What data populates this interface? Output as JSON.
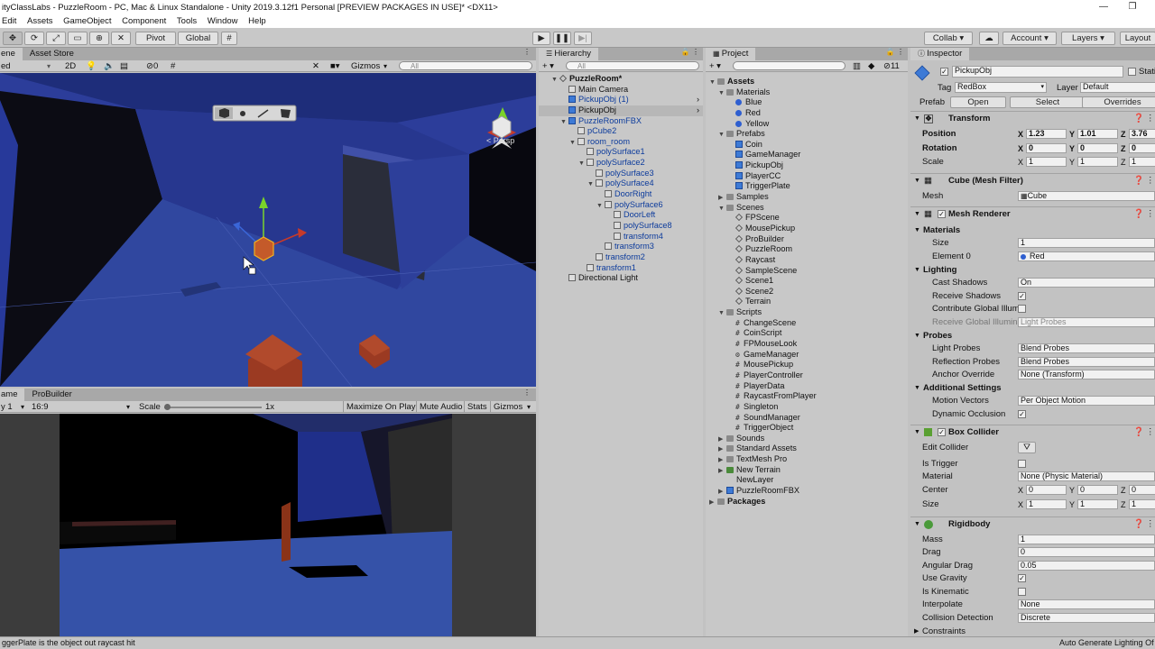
{
  "window": {
    "title": "ityClassLabs - PuzzleRoom - PC, Mac & Linux Standalone - Unity 2019.3.12f1 Personal [PREVIEW PACKAGES IN USE]* <DX11>"
  },
  "menu": [
    "Edit",
    "Assets",
    "GameObject",
    "Component",
    "Tools",
    "Window",
    "Help"
  ],
  "toolbar": {
    "pivot": "Pivot",
    "global": "Global",
    "collab": "Collab",
    "account": "Account",
    "layers": "Layers",
    "layout": "Layout"
  },
  "scene": {
    "tab_scene": "ene",
    "tab_store": "Asset Store",
    "shading": "ed",
    "mode2d": "2D",
    "hidden_count": "0",
    "gizmos": "Gizmos",
    "search_placeholder": "All",
    "persp": "Persp"
  },
  "game": {
    "tab_game": "ame",
    "tab_probuilder": "ProBuilder",
    "display": "y 1",
    "aspect": "16:9",
    "scale_label": "Scale",
    "scale_value": "1x",
    "scale_fraction": 0.0,
    "maximize": "Maximize On Play",
    "mute": "Mute Audio",
    "stats": "Stats",
    "gizmos": "Gizmos"
  },
  "hierarchy": {
    "tab": "Hierarchy",
    "search_placeholder": "All",
    "items": [
      {
        "label": "PuzzleRoom*",
        "depth": 0,
        "arrow": "▼",
        "icon": "unity",
        "bold": true
      },
      {
        "label": "Main Camera",
        "depth": 1,
        "arrow": "",
        "icon": "gray"
      },
      {
        "label": "PickupObj (1)",
        "depth": 1,
        "arrow": "",
        "icon": "blue",
        "blue": true,
        "chev": true
      },
      {
        "label": "PickupObj",
        "depth": 1,
        "arrow": "",
        "icon": "blue",
        "sel": true,
        "chev": true
      },
      {
        "label": "PuzzleRoomFBX",
        "depth": 1,
        "arrow": "▼",
        "icon": "blue",
        "blue": true
      },
      {
        "label": "pCube2",
        "depth": 2,
        "arrow": "",
        "icon": "gray",
        "blue": true
      },
      {
        "label": "room_room",
        "depth": 2,
        "arrow": "▼",
        "icon": "gray",
        "blue": true
      },
      {
        "label": "polySurface1",
        "depth": 3,
        "arrow": "",
        "icon": "gray",
        "blue": true
      },
      {
        "label": "polySurface2",
        "depth": 3,
        "arrow": "▼",
        "icon": "gray",
        "blue": true
      },
      {
        "label": "polySurface3",
        "depth": 4,
        "arrow": "",
        "icon": "gray",
        "blue": true
      },
      {
        "label": "polySurface4",
        "depth": 4,
        "arrow": "▼",
        "icon": "gray",
        "blue": true
      },
      {
        "label": "DoorRight",
        "depth": 5,
        "arrow": "",
        "icon": "gray",
        "blue": true
      },
      {
        "label": "polySurface6",
        "depth": 5,
        "arrow": "▼",
        "icon": "gray",
        "blue": true
      },
      {
        "label": "DoorLeft",
        "depth": 6,
        "arrow": "",
        "icon": "gray",
        "blue": true
      },
      {
        "label": "polySurface8",
        "depth": 6,
        "arrow": "",
        "icon": "gray",
        "blue": true
      },
      {
        "label": "transform4",
        "depth": 6,
        "arrow": "",
        "icon": "gray",
        "blue": true
      },
      {
        "label": "transform3",
        "depth": 5,
        "arrow": "",
        "icon": "gray",
        "blue": true
      },
      {
        "label": "transform2",
        "depth": 4,
        "arrow": "",
        "icon": "gray",
        "blue": true
      },
      {
        "label": "transform1",
        "depth": 3,
        "arrow": "",
        "icon": "gray",
        "blue": true
      },
      {
        "label": "Directional Light",
        "depth": 1,
        "arrow": "",
        "icon": "gray"
      }
    ]
  },
  "project": {
    "tab": "Project",
    "hidden_count": "11",
    "items": [
      {
        "label": "Assets",
        "depth": 0,
        "arrow": "▼",
        "icon": "folder",
        "bold": true
      },
      {
        "label": "Materials",
        "depth": 1,
        "arrow": "▼",
        "icon": "folder"
      },
      {
        "label": "Blue",
        "depth": 2,
        "arrow": "",
        "icon": "dot",
        "color": "#2f5fd0"
      },
      {
        "label": "Red",
        "depth": 2,
        "arrow": "",
        "icon": "dot",
        "color": "#2f5fd0"
      },
      {
        "label": "Yellow",
        "depth": 2,
        "arrow": "",
        "icon": "dot",
        "color": "#2f5fd0"
      },
      {
        "label": "Prefabs",
        "depth": 1,
        "arrow": "▼",
        "icon": "folder"
      },
      {
        "label": "Coin",
        "depth": 2,
        "arrow": "",
        "icon": "blue"
      },
      {
        "label": "GameManager",
        "depth": 2,
        "arrow": "",
        "icon": "blue"
      },
      {
        "label": "PickupObj",
        "depth": 2,
        "arrow": "",
        "icon": "blue"
      },
      {
        "label": "PlayerCC",
        "depth": 2,
        "arrow": "",
        "icon": "blue"
      },
      {
        "label": "TriggerPlate",
        "depth": 2,
        "arrow": "",
        "icon": "blue"
      },
      {
        "label": "Samples",
        "depth": 1,
        "arrow": "▶",
        "icon": "folder"
      },
      {
        "label": "Scenes",
        "depth": 1,
        "arrow": "▼",
        "icon": "folder"
      },
      {
        "label": "FPScene",
        "depth": 2,
        "arrow": "",
        "icon": "unity"
      },
      {
        "label": "MousePickup",
        "depth": 2,
        "arrow": "",
        "icon": "unity"
      },
      {
        "label": "ProBuilder",
        "depth": 2,
        "arrow": "",
        "icon": "unity"
      },
      {
        "label": "PuzzleRoom",
        "depth": 2,
        "arrow": "",
        "icon": "unity"
      },
      {
        "label": "Raycast",
        "depth": 2,
        "arrow": "",
        "icon": "unity"
      },
      {
        "label": "SampleScene",
        "depth": 2,
        "arrow": "",
        "icon": "unity"
      },
      {
        "label": "Scene1",
        "depth": 2,
        "arrow": "",
        "icon": "unity"
      },
      {
        "label": "Scene2",
        "depth": 2,
        "arrow": "",
        "icon": "unity"
      },
      {
        "label": "Terrain",
        "depth": 2,
        "arrow": "",
        "icon": "unity"
      },
      {
        "label": "Scripts",
        "depth": 1,
        "arrow": "▼",
        "icon": "folder"
      },
      {
        "label": "ChangeScene",
        "depth": 2,
        "arrow": "",
        "icon": "script"
      },
      {
        "label": "CoinScript",
        "depth": 2,
        "arrow": "",
        "icon": "script"
      },
      {
        "label": "FPMouseLook",
        "depth": 2,
        "arrow": "",
        "icon": "script"
      },
      {
        "label": "GameManager",
        "depth": 2,
        "arrow": "",
        "icon": "gear"
      },
      {
        "label": "MousePickup",
        "depth": 2,
        "arrow": "",
        "icon": "script"
      },
      {
        "label": "PlayerController",
        "depth": 2,
        "arrow": "",
        "icon": "script"
      },
      {
        "label": "PlayerData",
        "depth": 2,
        "arrow": "",
        "icon": "script"
      },
      {
        "label": "RaycastFromPlayer",
        "depth": 2,
        "arrow": "",
        "icon": "script"
      },
      {
        "label": "Singleton",
        "depth": 2,
        "arrow": "",
        "icon": "script"
      },
      {
        "label": "SoundManager",
        "depth": 2,
        "arrow": "",
        "icon": "script"
      },
      {
        "label": "TriggerObject",
        "depth": 2,
        "arrow": "",
        "icon": "script"
      },
      {
        "label": "Sounds",
        "depth": 1,
        "arrow": "▶",
        "icon": "folder"
      },
      {
        "label": "Standard Assets",
        "depth": 1,
        "arrow": "▶",
        "icon": "folder"
      },
      {
        "label": "TextMesh Pro",
        "depth": 1,
        "arrow": "▶",
        "icon": "folder"
      },
      {
        "label": "New Terrain",
        "depth": 1,
        "arrow": "▶",
        "icon": "terrain"
      },
      {
        "label": "NewLayer",
        "depth": 1,
        "arrow": "",
        "icon": "none"
      },
      {
        "label": "PuzzleRoomFBX",
        "depth": 1,
        "arrow": "▶",
        "icon": "blue"
      },
      {
        "label": "Packages",
        "depth": 0,
        "arrow": "▶",
        "icon": "folder",
        "bold": true
      }
    ]
  },
  "inspector": {
    "tab": "Inspector",
    "name": "PickupObj",
    "static": "Stati",
    "tag_label": "Tag",
    "tag": "RedBox",
    "layer_label": "Layer",
    "layer": "Default",
    "prefab_label": "Prefab",
    "open": "Open",
    "select": "Select",
    "overrides": "Overrides",
    "transform": {
      "title": "Transform",
      "position": "Position",
      "rotation": "Rotation",
      "scale": "Scale",
      "pos": [
        "1.23",
        "1.01",
        "3.76"
      ],
      "rot": [
        "0",
        "0",
        "0"
      ],
      "scl": [
        "1",
        "1",
        "1"
      ]
    },
    "mesh_filter": {
      "title": "Cube (Mesh Filter)",
      "mesh_label": "Mesh",
      "mesh": "Cube"
    },
    "mesh_renderer": {
      "title": "Mesh Renderer",
      "materials": "Materials",
      "size_label": "Size",
      "size": "1",
      "element0_label": "Element 0",
      "element0": "Red",
      "lighting": "Lighting",
      "cast_shadows_label": "Cast Shadows",
      "cast_shadows": "On",
      "receive_shadows": "Receive Shadows",
      "contribute_gi": "Contribute Global Illum",
      "receive_gi": "Receive Global Illumina",
      "receive_gi_value": "Light Probes",
      "probes": "Probes",
      "light_probes_label": "Light Probes",
      "light_probes": "Blend Probes",
      "reflection_probes_label": "Reflection Probes",
      "reflection_probes": "Blend Probes",
      "anchor_label": "Anchor Override",
      "anchor": "None (Transform)",
      "additional": "Additional Settings",
      "motion_label": "Motion Vectors",
      "motion": "Per Object Motion",
      "dynamic_occlusion": "Dynamic Occlusion"
    },
    "box_collider": {
      "title": "Box Collider",
      "edit_collider": "Edit Collider",
      "is_trigger": "Is Trigger",
      "material_label": "Material",
      "material": "None (Physic Material)",
      "center_label": "Center",
      "size_label": "Size",
      "center": [
        "0",
        "0",
        "0"
      ],
      "size": [
        "1",
        "1",
        "1"
      ]
    },
    "rigidbody": {
      "title": "Rigidbody",
      "mass_label": "Mass",
      "mass": "1",
      "drag_label": "Drag",
      "drag": "0",
      "angular_label": "Angular Drag",
      "angular": "0.05",
      "use_gravity": "Use Gravity",
      "is_kinematic": "Is Kinematic",
      "interpolate_label": "Interpolate",
      "interpolate": "None",
      "collision_label": "Collision Detection",
      "collision": "Discrete",
      "constraints": "Constraints"
    }
  },
  "status": {
    "message": "ggerPlate is the object out raycast hit",
    "right": "Auto Generate Lighting Of"
  },
  "colors": {
    "scene_bg": "#2c3d9a",
    "floor": "#30479f",
    "box": "#9b3a22",
    "game_floor": "#3552a8"
  }
}
